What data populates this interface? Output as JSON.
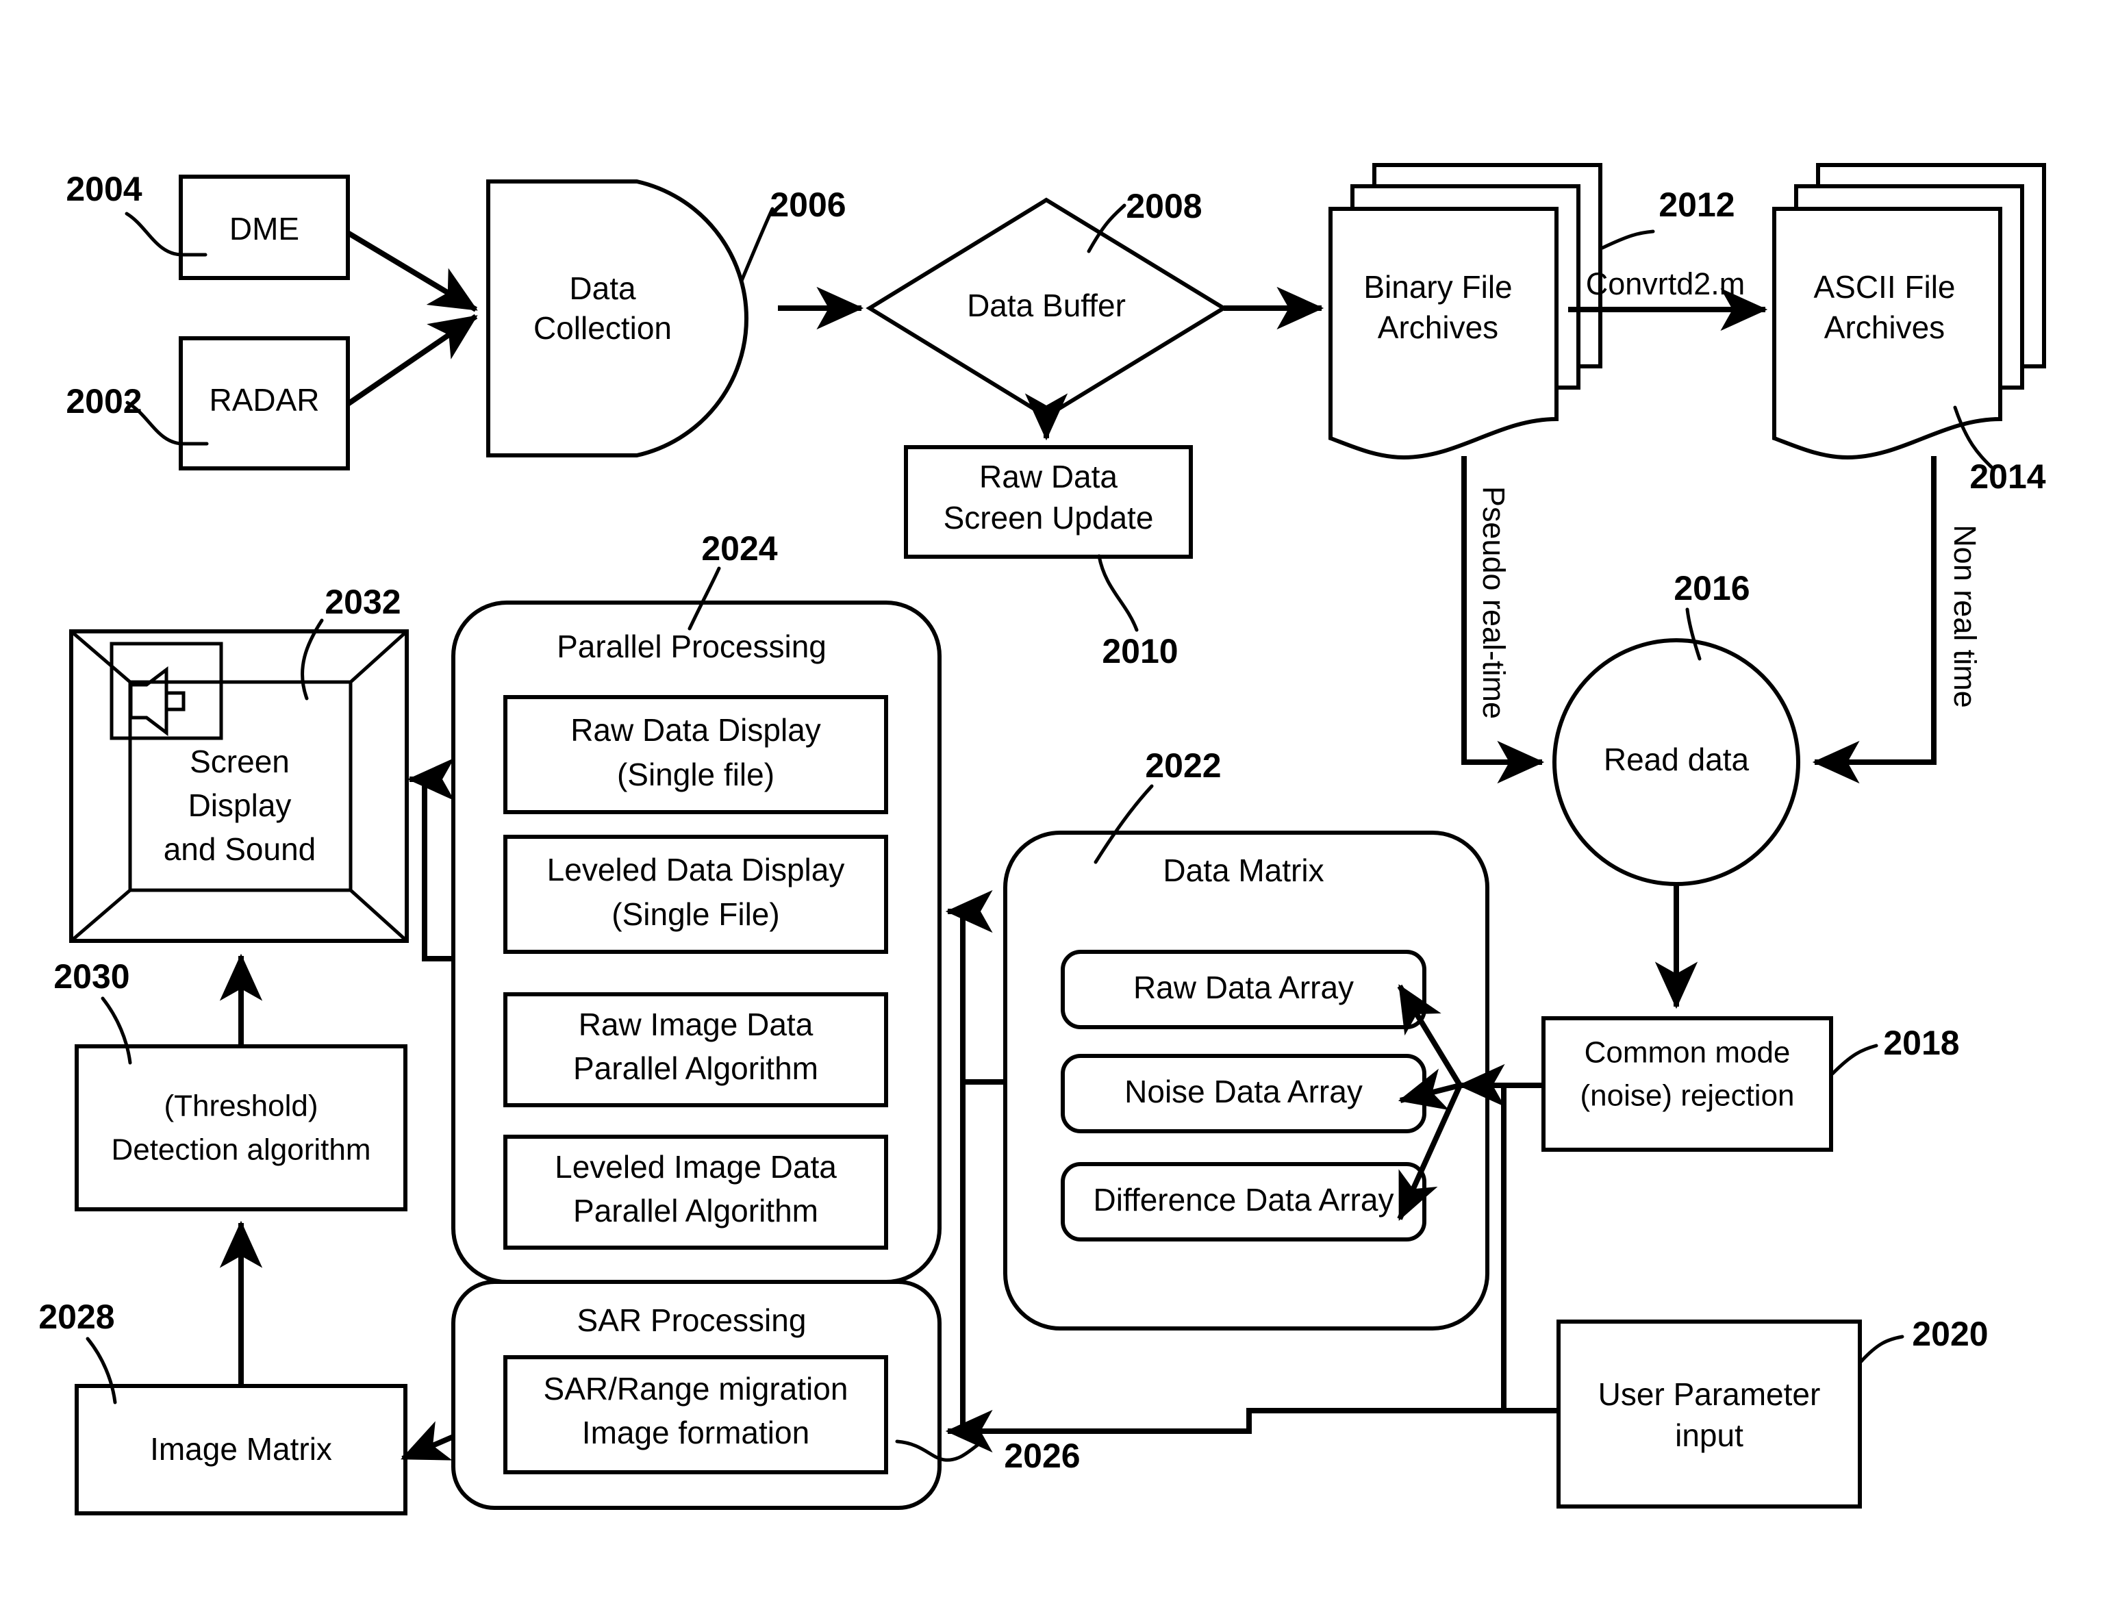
{
  "figure": {
    "title": "Radar/DME data collection, archival and SAR processing flow diagram",
    "line_color": "#000000",
    "background_color": "#ffffff"
  },
  "nodes": {
    "dme": {
      "ref": "2004",
      "label": "DME",
      "shape": "rectangle"
    },
    "radar": {
      "ref": "2002",
      "label": "RADAR",
      "shape": "rectangle"
    },
    "data_collection": {
      "ref": "2006",
      "label_line1": "Data",
      "label_line2": "Collection",
      "shape": "d-shape"
    },
    "data_buffer": {
      "ref": "2008",
      "label": "Data Buffer",
      "shape": "diamond"
    },
    "raw_data_screen_update": {
      "ref": "2010",
      "label_line1": "Raw Data",
      "label_line2": "Screen Update",
      "shape": "rectangle"
    },
    "binary_file_archives": {
      "ref": "2012",
      "label_line1": "Binary File",
      "label_line2": "Archives",
      "shape": "document-stack"
    },
    "ascii_file_archives": {
      "ref": "2014",
      "label_line1": "ASCII File",
      "label_line2": "Archives",
      "shape": "document-stack"
    },
    "read_data": {
      "ref": "2016",
      "label": "Read data",
      "shape": "circle"
    },
    "common_mode_rejection": {
      "ref": "2018",
      "label_line1": "Common mode",
      "label_line2": "(noise) rejection",
      "shape": "rectangle"
    },
    "user_parameter_input": {
      "ref": "2020",
      "label_line1": "User Parameter",
      "label_line2": "input",
      "shape": "rectangle"
    },
    "data_matrix": {
      "ref": "2022",
      "title": "Data Matrix",
      "shape": "rounded-rectangle",
      "items": [
        {
          "label": "Raw Data Array"
        },
        {
          "label": "Noise Data Array"
        },
        {
          "label": "Difference Data Array"
        }
      ]
    },
    "parallel_processing": {
      "ref": "2024",
      "title": "Parallel Processing",
      "shape": "rounded-rectangle",
      "items": [
        {
          "line1": "Raw Data Display",
          "line2": "(Single file)"
        },
        {
          "line1": "Leveled Data Display",
          "line2": "(Single File)"
        },
        {
          "line1": "Raw Image Data",
          "line2": "Parallel Algorithm"
        },
        {
          "line1": "Leveled Image Data",
          "line2": "Parallel Algorithm"
        }
      ]
    },
    "sar_processing": {
      "ref": "2026",
      "title": "SAR Processing",
      "shape": "rounded-rectangle",
      "items": [
        {
          "line1": "SAR/Range migration",
          "line2": "Image formation"
        }
      ]
    },
    "image_matrix": {
      "ref": "2028",
      "label": "Image Matrix",
      "shape": "rectangle"
    },
    "detection_algorithm": {
      "ref": "2030",
      "label_line1": "(Threshold)",
      "label_line2": "Detection algorithm",
      "shape": "rectangle"
    },
    "screen_display": {
      "ref": "2032",
      "label_line1": "Screen",
      "label_line2": "Display",
      "label_line3": "and Sound",
      "shape": "3d-monitor",
      "icon": "speaker-icon"
    }
  },
  "edge_labels": {
    "convert_script": "Convrtd2.m",
    "pseudo_real_time": "Pseudo real-time",
    "non_real_time": "Non real time"
  }
}
